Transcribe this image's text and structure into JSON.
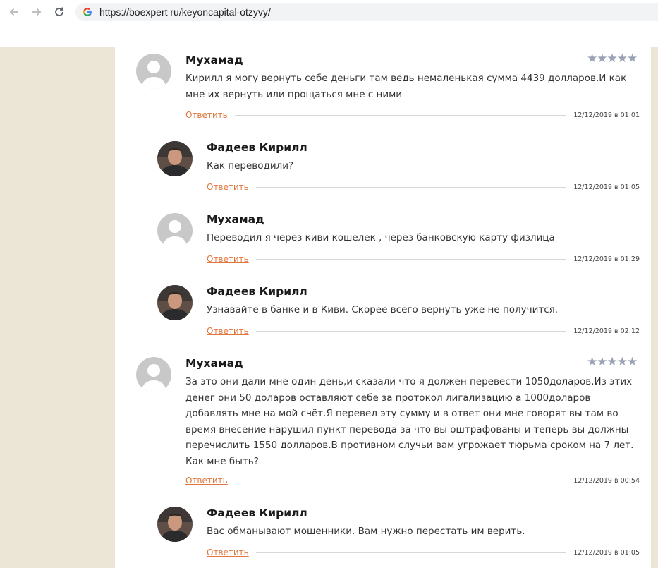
{
  "browser": {
    "url": "https://boexpert ru/keyoncapital-otzyvy/"
  },
  "colors": {
    "accent": "#e0773f",
    "page_bg": "#ebe6d6",
    "stars": "#9aa3b5"
  },
  "comments": [
    {
      "author": "Мухамад",
      "avatar": "default-avatar",
      "rating": 5,
      "text": "Кирилл я могу вернуть себе деньги там ведь немаленькая сумма 4439 долларов.И как мне их вернуть или прощаться мне с ними",
      "reply_label": "Ответить",
      "date": "12/12/2019 в 01:01"
    },
    {
      "author": "Фадеев Кирилл",
      "avatar": "photo-avatar",
      "text": "Как переводили?",
      "reply_label": "Ответить",
      "date": "12/12/2019 в 01:05"
    },
    {
      "author": "Мухамад",
      "avatar": "default-avatar",
      "text": "Переводил я через киви кошелек , через банковскую карту физлица",
      "reply_label": "Ответить",
      "date": "12/12/2019 в 01:29"
    },
    {
      "author": "Фадеев Кирилл",
      "avatar": "photo-avatar",
      "text": "Узнавайте в банке и в Киви. Скорее всего вернуть уже не получится.",
      "reply_label": "Ответить",
      "date": "12/12/2019 в 02:12"
    },
    {
      "author": "Мухамад",
      "avatar": "default-avatar",
      "rating": 5,
      "text": "За это они дали мне один день,и сказали что я должен перевести 1050доларов.Из этих денег они 50 доларов оставляют себе за протокол лигализацию а 1000доларов добавлять мне на мой счёт.Я перевел эту сумму и в ответ они мне говорят вы там во время внесение нарушил пункт перевода за что вы оштрафованы и теперь вы должны перечислить 1550 долларов.В противном случьи вам угрожает тюрьма сроком на 7 лет. Как мне быть?",
      "reply_label": "Ответить",
      "date": "12/12/2019 в 00:54"
    },
    {
      "author": "Фадеев Кирилл",
      "avatar": "photo-avatar",
      "text": "Вас обманывают мошенники. Вам нужно перестать им верить.",
      "reply_label": "Ответить",
      "date": "12/12/2019 в 01:05"
    }
  ]
}
